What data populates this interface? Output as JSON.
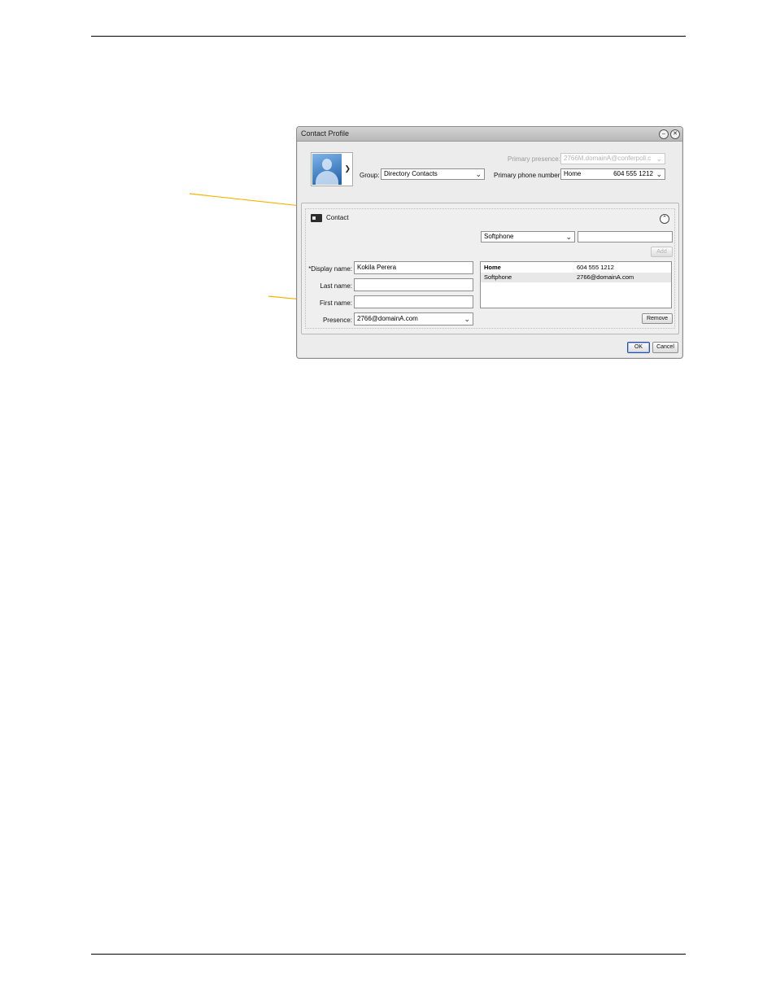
{
  "dialog": {
    "title": "Contact Profile",
    "minimize_icon": "minimize-icon",
    "close_icon": "close-icon"
  },
  "header": {
    "group_label": "Group:",
    "group_value": "Directory Contacts",
    "primary_presence_label": "Primary presence:",
    "primary_presence_value": "2766M.domainA@conferpoll.c",
    "primary_phone_label": "Primary phone number:",
    "primary_phone_type": "Home",
    "primary_phone_value": "604 555 1212"
  },
  "section": {
    "title": "Contact",
    "icon": "contact-card-icon"
  },
  "form": {
    "display_name_label": "*Display name:",
    "display_name_value": "Kokila Perera",
    "last_name_label": "Last name:",
    "last_name_value": "",
    "first_name_label": "First name:",
    "first_name_value": "",
    "presence_label": "Presence:",
    "presence_value": "2766@domainA.com"
  },
  "phone_entry": {
    "type_value": "Softphone",
    "number_value": "",
    "add_label": "Add",
    "remove_label": "Remove"
  },
  "numbers": [
    {
      "type": "Home",
      "value": "604 555 1212"
    },
    {
      "type": "Softphone",
      "value": "2766@domainA.com"
    }
  ],
  "footer": {
    "ok_label": "OK",
    "cancel_label": "Cancel"
  },
  "colors": {
    "callout_line": "#f5b400"
  }
}
